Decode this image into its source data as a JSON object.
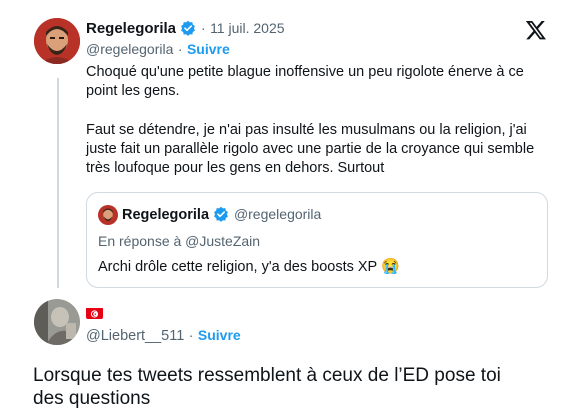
{
  "tweet1": {
    "display_name": "Regelegorila",
    "date": "11 juil. 2025",
    "separator": "·",
    "handle": "@regelegorila",
    "dot": "·",
    "follow_label": "Suivre",
    "text_p1": "Choqué qu'une petite blague inoffensive un peu rigolote énerve à ce point les gens.",
    "text_p2": "Faut se détendre, je n'ai pas insulté les musulmans ou la religion, j'ai juste fait un parallèle rigolo avec une partie de la croyance qui semble très loufoque pour les gens en dehors. Surtout",
    "logo_icon": "x-logo-icon"
  },
  "quote": {
    "display_name": "Regelegorila",
    "handle": "@regelegorila",
    "reply_to": "En réponse à @JusteZain",
    "text": "Archi drôle cette religion, y'a des boosts XP",
    "emoji": "😭"
  },
  "tweet2": {
    "flag_icon": "tunisia-flag-icon",
    "handle": "@Liebert__511",
    "dot": "·",
    "follow_label": "Suivre",
    "text": "Lorsque tes tweets ressemblent à ceux de l’ED pose toi des questions"
  },
  "colors": {
    "accent": "#1d9bf0",
    "muted": "#536471",
    "border": "#cfd9de",
    "flag_red": "#e70013"
  }
}
